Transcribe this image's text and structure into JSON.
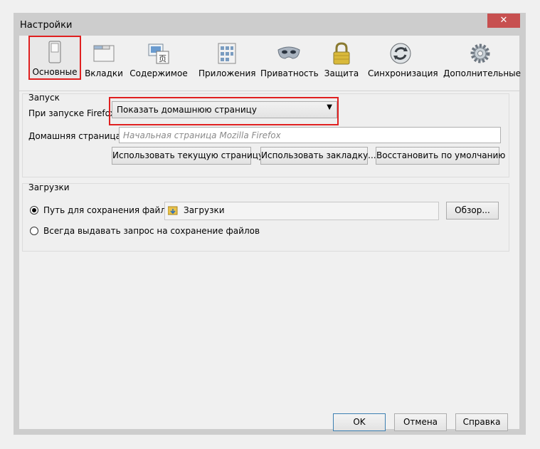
{
  "window": {
    "title": "Настройки",
    "close_symbol": "✕"
  },
  "panes": [
    {
      "label": "Основные",
      "icon": "switch-icon",
      "selected": true
    },
    {
      "label": "Вкладки",
      "icon": "tabs-icon",
      "selected": false
    },
    {
      "label": "Содержимое",
      "icon": "content-icon",
      "selected": false
    },
    {
      "label": "Приложения",
      "icon": "applications-icon",
      "selected": false
    },
    {
      "label": "Приватность",
      "icon": "mask-icon",
      "selected": false
    },
    {
      "label": "Защита",
      "icon": "lock-icon",
      "selected": false
    },
    {
      "label": "Синхронизация",
      "icon": "sync-icon",
      "selected": false
    },
    {
      "label": "Дополнительные",
      "icon": "gear-icon",
      "selected": false
    }
  ],
  "startup": {
    "group_title": "Запуск",
    "when_starts_label": "При запуске Firefox:",
    "when_starts_value": "Показать домашнюю страницу",
    "homepage_label": "Домашняя страница:",
    "homepage_placeholder": "Начальная страница Mozilla Firefox",
    "use_current_button": "Использовать текущую страницу",
    "use_bookmark_button": "Использовать закладку...",
    "restore_default_button": "Восстановить по умолчанию"
  },
  "downloads": {
    "group_title": "Загрузки",
    "save_to_label": "Путь для сохранения файлов",
    "save_to_folder": "Загрузки",
    "browse_button": "Обзор...",
    "always_ask_label": "Всегда выдавать запрос на сохранение файлов",
    "save_to_checked": true
  },
  "footer": {
    "ok": "OK",
    "cancel": "Отмена",
    "help": "Справка"
  },
  "colors": {
    "highlight": "#e02020",
    "close": "#c75050"
  }
}
